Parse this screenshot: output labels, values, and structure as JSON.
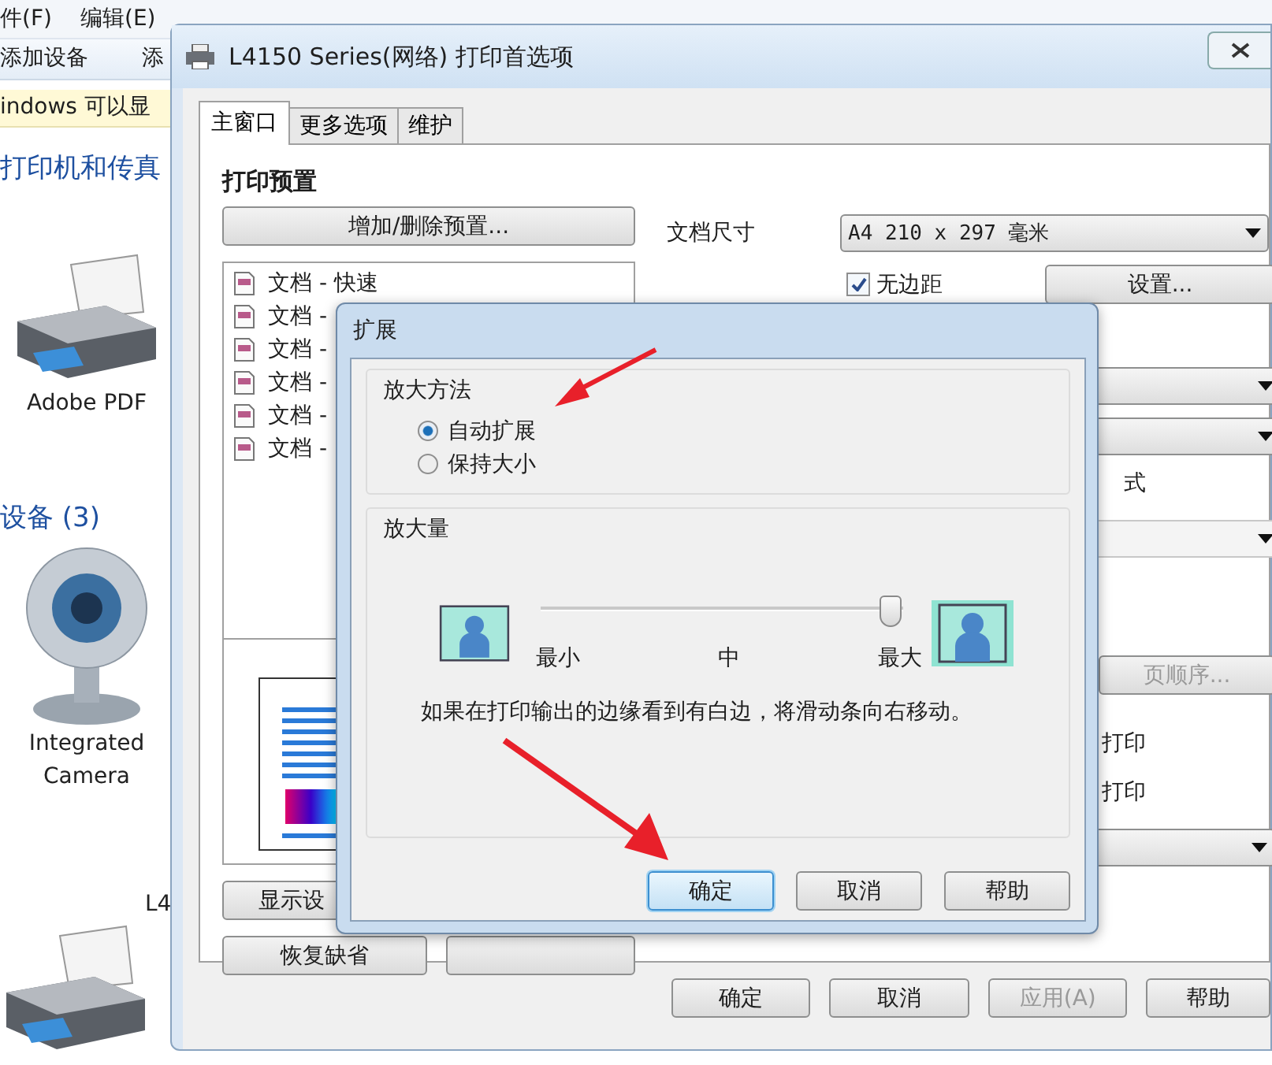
{
  "explorer": {
    "menu": [
      "件(F)",
      "编辑(E)"
    ],
    "toolbar": [
      "添加设备",
      "添"
    ],
    "info_bar": "indows 可以显",
    "section": "打印机和传真",
    "devices_header": "设备 (3)",
    "printers": [
      {
        "label": "Adobe PDF"
      }
    ],
    "devices": [
      {
        "label": "Integrated Camera"
      }
    ],
    "bottom_item": {
      "label": "L4"
    }
  },
  "window": {
    "title": "L4150 Series(网络) 打印首选项",
    "tabs": [
      {
        "label": "主窗口",
        "selected": true
      },
      {
        "label": "更多选项",
        "selected": false
      },
      {
        "label": "维护",
        "selected": false
      }
    ],
    "presets_title": "打印预置",
    "presets_button": "增加/删除预置...",
    "presets": [
      {
        "label": "文档 - 快速"
      },
      {
        "label": "文档 -"
      },
      {
        "label": "文档 -"
      },
      {
        "label": "文档 -"
      },
      {
        "label": "文档 -"
      },
      {
        "label": "文档 -"
      }
    ],
    "left_buttons": [
      "显示设",
      "恢复缺省"
    ],
    "paper_label": "文档尺寸",
    "paper_size": "A4 210 x 297 毫米",
    "borderless": {
      "label": "无边距",
      "checked": true
    },
    "settings_button": "设置...",
    "mode_fragment": "式",
    "page_order_button": "页顺序...",
    "print_fragments": [
      "打印",
      "打印"
    ],
    "buttons": [
      {
        "label": "确定",
        "disabled": false
      },
      {
        "label": "取消",
        "disabled": false
      },
      {
        "label": "应用(A)",
        "disabled": true
      },
      {
        "label": "帮助",
        "disabled": false
      }
    ]
  },
  "dialog": {
    "title": "扩展",
    "method": {
      "title": "放大方法",
      "options": [
        {
          "label": "自动扩展",
          "selected": true
        },
        {
          "label": "保持大小",
          "selected": false
        }
      ]
    },
    "amount": {
      "title": "放大量",
      "level": 1,
      "ticks": [
        "最小",
        "中",
        "最大"
      ]
    },
    "hint": "如果在打印输出的边缘看到有白边，将滑动条向右移动。",
    "buttons": [
      {
        "label": "确定",
        "focused": true
      },
      {
        "label": "取消",
        "focused": false
      },
      {
        "label": "帮助",
        "focused": false
      }
    ]
  }
}
